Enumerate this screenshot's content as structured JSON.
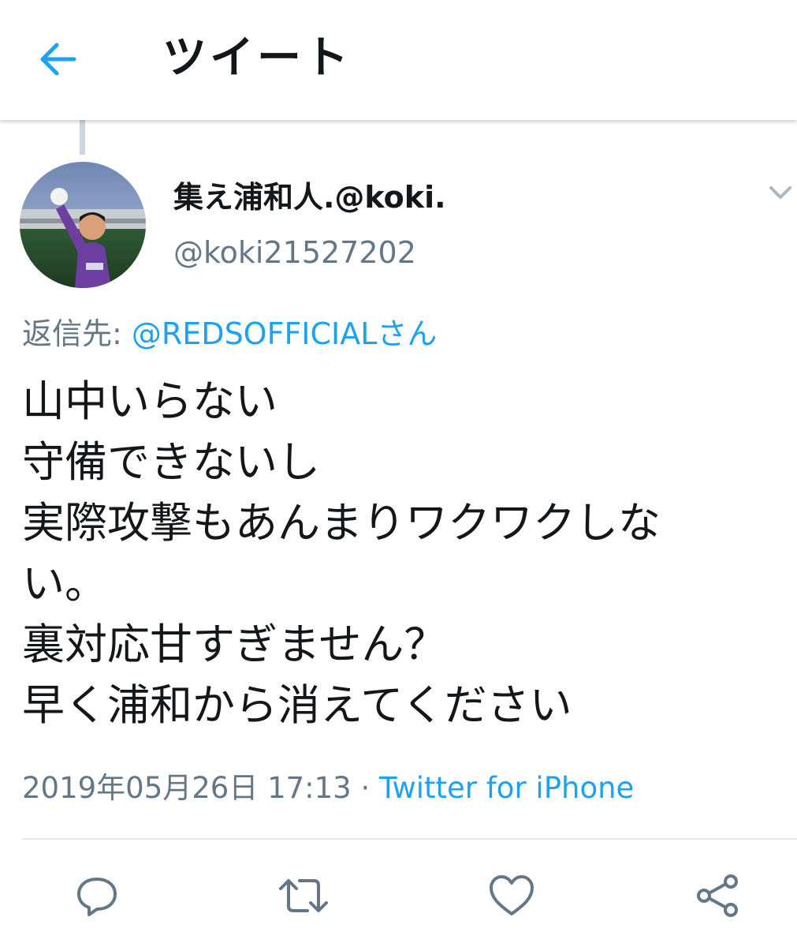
{
  "header": {
    "title": "ツイート",
    "back_icon": "arrow-left-icon"
  },
  "colors": {
    "accent": "#1da1f2",
    "secondary_text": "#657786",
    "primary_text": "#14171a",
    "divider": "#e1e8ed",
    "icon": "#657786"
  },
  "tweet": {
    "user": {
      "display_name": "集え浦和人.@koki.",
      "handle": "@koki21527202"
    },
    "reply": {
      "label": "返信先: ",
      "target": "@REDSOFFICIALさん"
    },
    "text_lines": [
      "山中いらない",
      "守備できないし",
      "実際攻撃もあんまりワクワクしな",
      "い。",
      "裏対応甘すぎません？",
      "早く浦和から消えてください"
    ],
    "timestamp": "2019年05月26日 17:13",
    "separator": " · ",
    "client": "Twitter for iPhone"
  },
  "actions": [
    {
      "name": "reply",
      "icon": "reply-icon"
    },
    {
      "name": "retweet",
      "icon": "retweet-icon"
    },
    {
      "name": "like",
      "icon": "heart-icon"
    },
    {
      "name": "share",
      "icon": "share-icon"
    }
  ]
}
